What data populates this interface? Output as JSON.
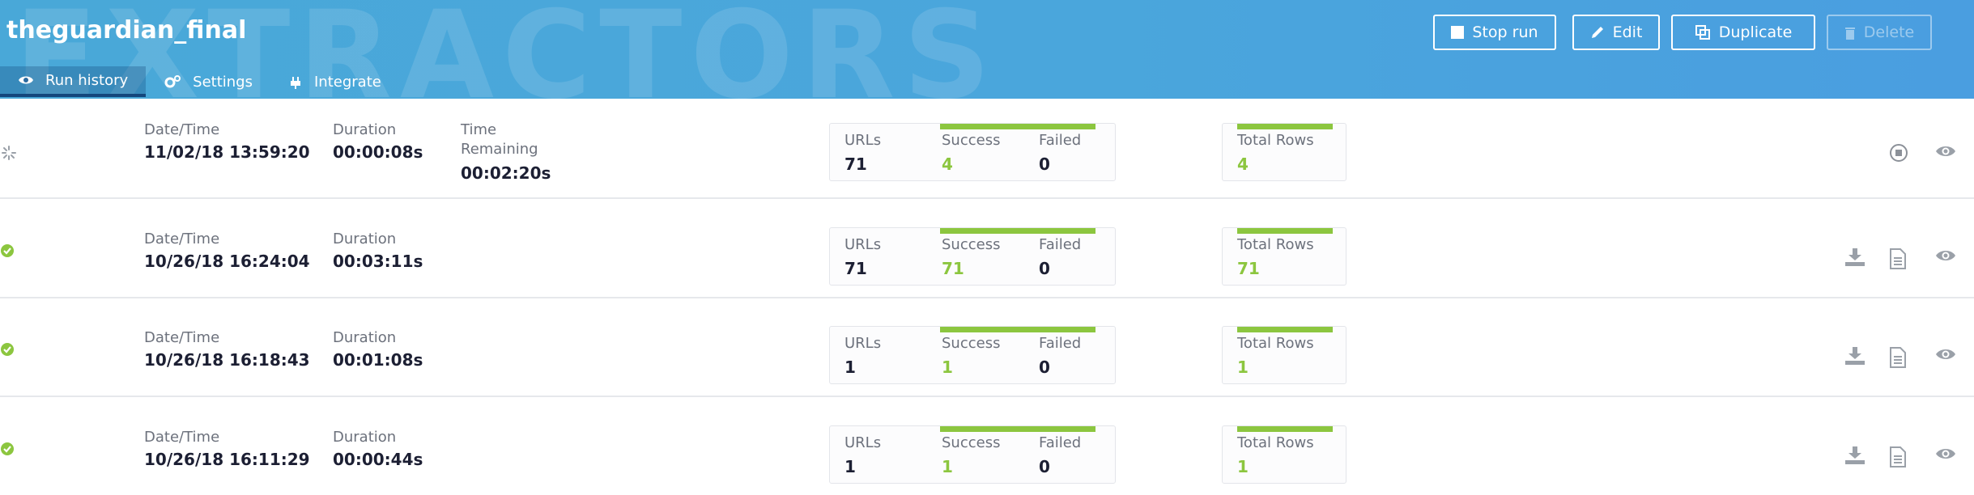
{
  "header": {
    "title": "theguardian_final",
    "watermark": "EXTRACTORS",
    "tabs": [
      {
        "label": "Run history",
        "icon": "eye-icon"
      },
      {
        "label": "Settings",
        "icon": "gears-icon"
      },
      {
        "label": "Integrate",
        "icon": "plug-icon"
      }
    ],
    "buttons": {
      "stop_run": "Stop run",
      "edit": "Edit",
      "duplicate": "Duplicate",
      "delete": "Delete"
    }
  },
  "colors": {
    "header": "#49a8d8",
    "success": "#8cc63f",
    "tab_active": "#14467c"
  },
  "runs": [
    {
      "status": "running",
      "date_label": "Date/Time",
      "date": "11/02/18 13:59:20",
      "duration_label": "Duration",
      "duration": "00:00:08s",
      "remaining_label_1": "Time",
      "remaining_label_2": "Remaining",
      "remaining": "00:02:20s",
      "urls_label": "URLs",
      "urls": "71",
      "success_label": "Success",
      "success": "4",
      "failed_label": "Failed",
      "failed": "0",
      "rows_label": "Total Rows",
      "rows": "4",
      "actions": [
        "stop-icon",
        "eye-icon"
      ]
    },
    {
      "status": "success",
      "date_label": "Date/Time",
      "date": "10/26/18 16:24:04",
      "duration_label": "Duration",
      "duration": "00:03:11s",
      "urls_label": "URLs",
      "urls": "71",
      "success_label": "Success",
      "success": "71",
      "failed_label": "Failed",
      "failed": "0",
      "rows_label": "Total Rows",
      "rows": "71",
      "actions": [
        "download-icon",
        "document-icon",
        "eye-icon"
      ]
    },
    {
      "status": "success",
      "date_label": "Date/Time",
      "date": "10/26/18 16:18:43",
      "duration_label": "Duration",
      "duration": "00:01:08s",
      "urls_label": "URLs",
      "urls": "1",
      "success_label": "Success",
      "success": "1",
      "failed_label": "Failed",
      "failed": "0",
      "rows_label": "Total Rows",
      "rows": "1",
      "actions": [
        "download-icon",
        "document-icon",
        "eye-icon"
      ]
    },
    {
      "status": "success",
      "date_label": "Date/Time",
      "date": "10/26/18 16:11:29",
      "duration_label": "Duration",
      "duration": "00:00:44s",
      "urls_label": "URLs",
      "urls": "1",
      "success_label": "Success",
      "success": "1",
      "failed_label": "Failed",
      "failed": "0",
      "rows_label": "Total Rows",
      "rows": "1",
      "actions": [
        "download-icon",
        "document-icon",
        "eye-icon"
      ]
    }
  ]
}
